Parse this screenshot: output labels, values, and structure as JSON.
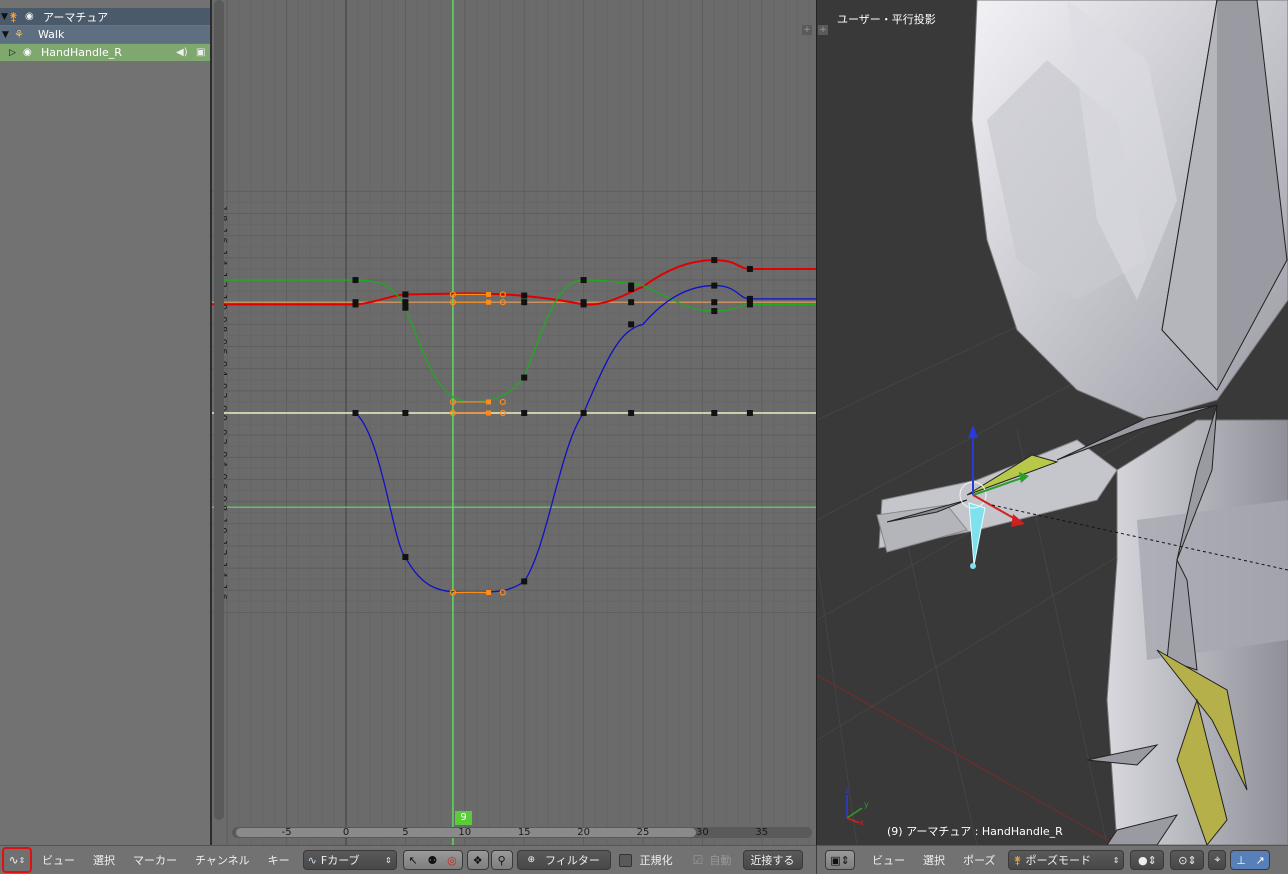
{
  "channels": [
    {
      "label": "アーマチュア",
      "kind": "object"
    },
    {
      "label": "Walk",
      "kind": "action"
    },
    {
      "label": "HandHandle_R",
      "kind": "group"
    }
  ],
  "graph": {
    "y_ticks": [
      "1.8",
      "1.6",
      "1.4",
      "1.2",
      "1.0",
      "0.8",
      "0.6",
      "0.4",
      "0.2",
      "0.0",
      "-0.2",
      "-0.4",
      "-0.6",
      "-0.8",
      "-1.0",
      "-1.2",
      "-1.4",
      "-1.6"
    ],
    "x_ticks": [
      "-5",
      "0",
      "5",
      "10",
      "15",
      "20",
      "25",
      "30",
      "35"
    ],
    "current_frame": "9",
    "colors": {
      "x": "#e00000",
      "y": "#1faa1f",
      "z": "#1010c8",
      "selected": "#ff8c1a",
      "playhead": "#60e060"
    }
  },
  "graph_header": {
    "menus": [
      "ビュー",
      "選択",
      "マーカー",
      "チャンネル",
      "キー"
    ],
    "mode": "Fカーブ",
    "filter": "フィルター",
    "normalize": "正規化",
    "auto": "自動",
    "near": "近接する"
  },
  "viewport": {
    "view_label": "ユーザー・平行投影",
    "status": "(9) アーマチュア : HandHandle_R",
    "menus": [
      "ビュー",
      "選択",
      "ポーズ"
    ],
    "mode": "ポーズモード"
  }
}
